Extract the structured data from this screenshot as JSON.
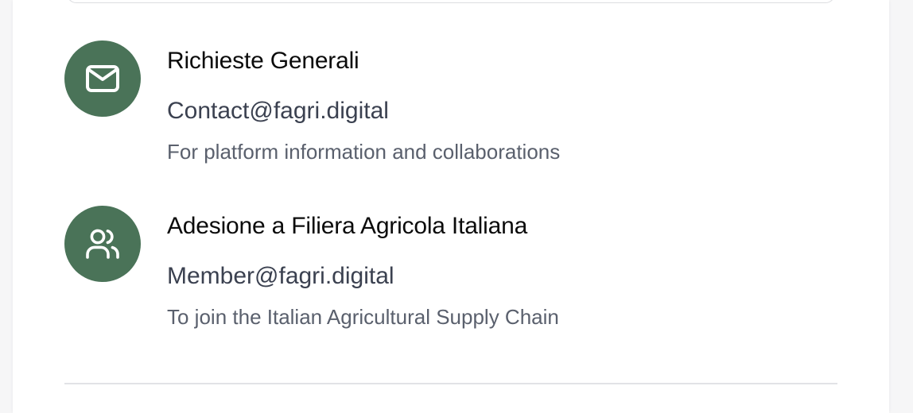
{
  "contacts": [
    {
      "title": "Richieste Generali",
      "email": "Contact@fagri.digital",
      "description": "For platform information and collaborations",
      "icon": "mail-icon"
    },
    {
      "title": "Adesione a Filiera Agricola Italiana",
      "email": "Member@fagri.digital",
      "description": "To join the Italian Agricultural Supply Chain",
      "icon": "users-icon"
    }
  ],
  "colors": {
    "accent": "#4a7358",
    "title_text": "#0b0b0b",
    "email_text": "#3b4150",
    "description_text": "#5a606d"
  }
}
